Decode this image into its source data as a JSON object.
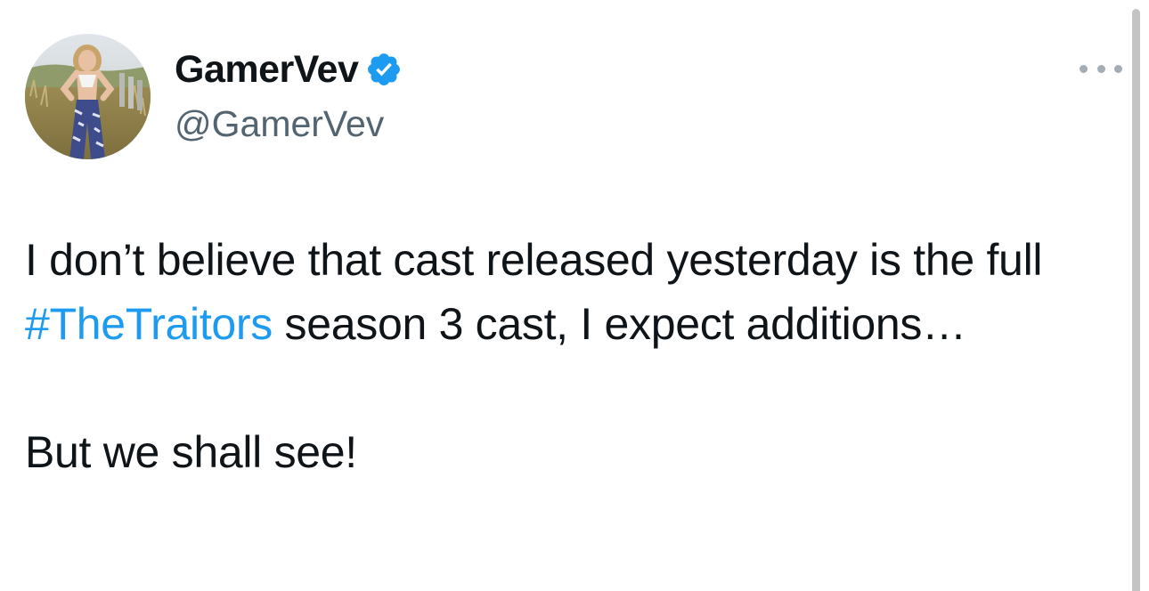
{
  "author": {
    "display_name": "GamerVev",
    "handle": "@GamerVev",
    "verified": true,
    "avatar_icon": "profile-photo"
  },
  "menu": {
    "icon": "more-options-icon"
  },
  "tweet": {
    "line_1_before": "I don’t believe that cast released yesterday is the full ",
    "hashtag": "#TheTraitors",
    "line_1_after": " season 3 cast, I expect additions…",
    "line_2": "But we shall see!"
  },
  "colors": {
    "link": "#1d9bf0",
    "verified_badge": "#1d9bf0",
    "text": "#0f1419",
    "muted": "#536471"
  }
}
